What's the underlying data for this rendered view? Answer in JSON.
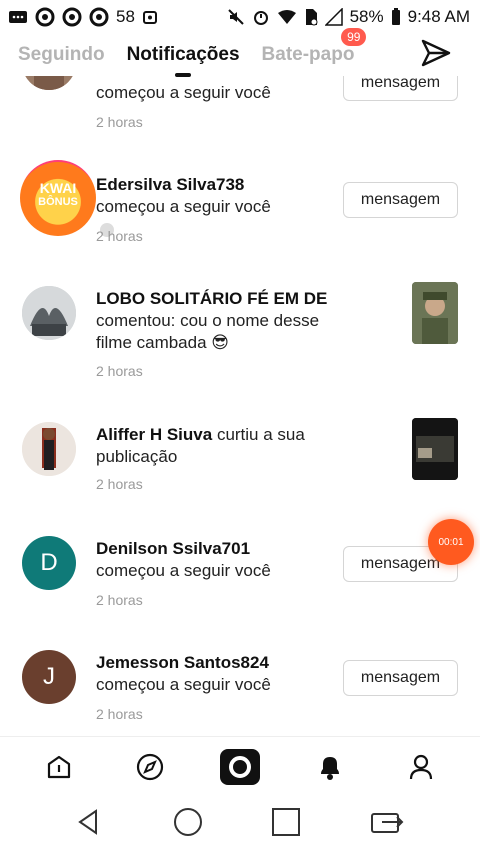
{
  "status_bar": {
    "notification_count": "58",
    "battery": "58%",
    "time": "9:48 AM"
  },
  "tabs": [
    {
      "label": "Seguindo",
      "active": false
    },
    {
      "label": "Notificações",
      "active": true
    },
    {
      "label": "Bate-papo",
      "active": false,
      "badge": "99"
    }
  ],
  "notifications": [
    {
      "user": "",
      "action": "começou a seguir você",
      "time": "2 horas",
      "button": "mensagem"
    },
    {
      "user": "Edersilva Silva738",
      "action": "começou a seguir você",
      "time": "2 horas",
      "button": "mensagem",
      "avatar_text_1": "KWAI",
      "avatar_text_2": "BÔNUS"
    },
    {
      "user": "LOBO SOLITÁRIO FÉ EM DE",
      "action": "comentou: cou o nome desse filme cambada 😎",
      "time": "2 horas"
    },
    {
      "user": "Aliffer H Siuva",
      "action": "curtiu a sua publicação",
      "time": "2 horas"
    },
    {
      "user": "Denilson Ssilva701",
      "action": "começou a seguir você",
      "time": "2 horas",
      "button": "mensagem",
      "avatar_letter": "D",
      "avatar_color": "#0f7a78"
    },
    {
      "user": "Jemesson Santos824",
      "action": "começou a seguir você",
      "time": "2 horas",
      "button": "mensagem",
      "avatar_letter": "J",
      "avatar_color": "#6a3f2e"
    }
  ],
  "floating_timer": "00:01",
  "bottom_nav": [
    "home-icon",
    "discover-icon",
    "camera-icon",
    "bell-icon",
    "profile-icon"
  ],
  "colors": {
    "accent": "#ff5a4e",
    "timer": "#ff5a1f",
    "muted": "#9a9a9a"
  }
}
